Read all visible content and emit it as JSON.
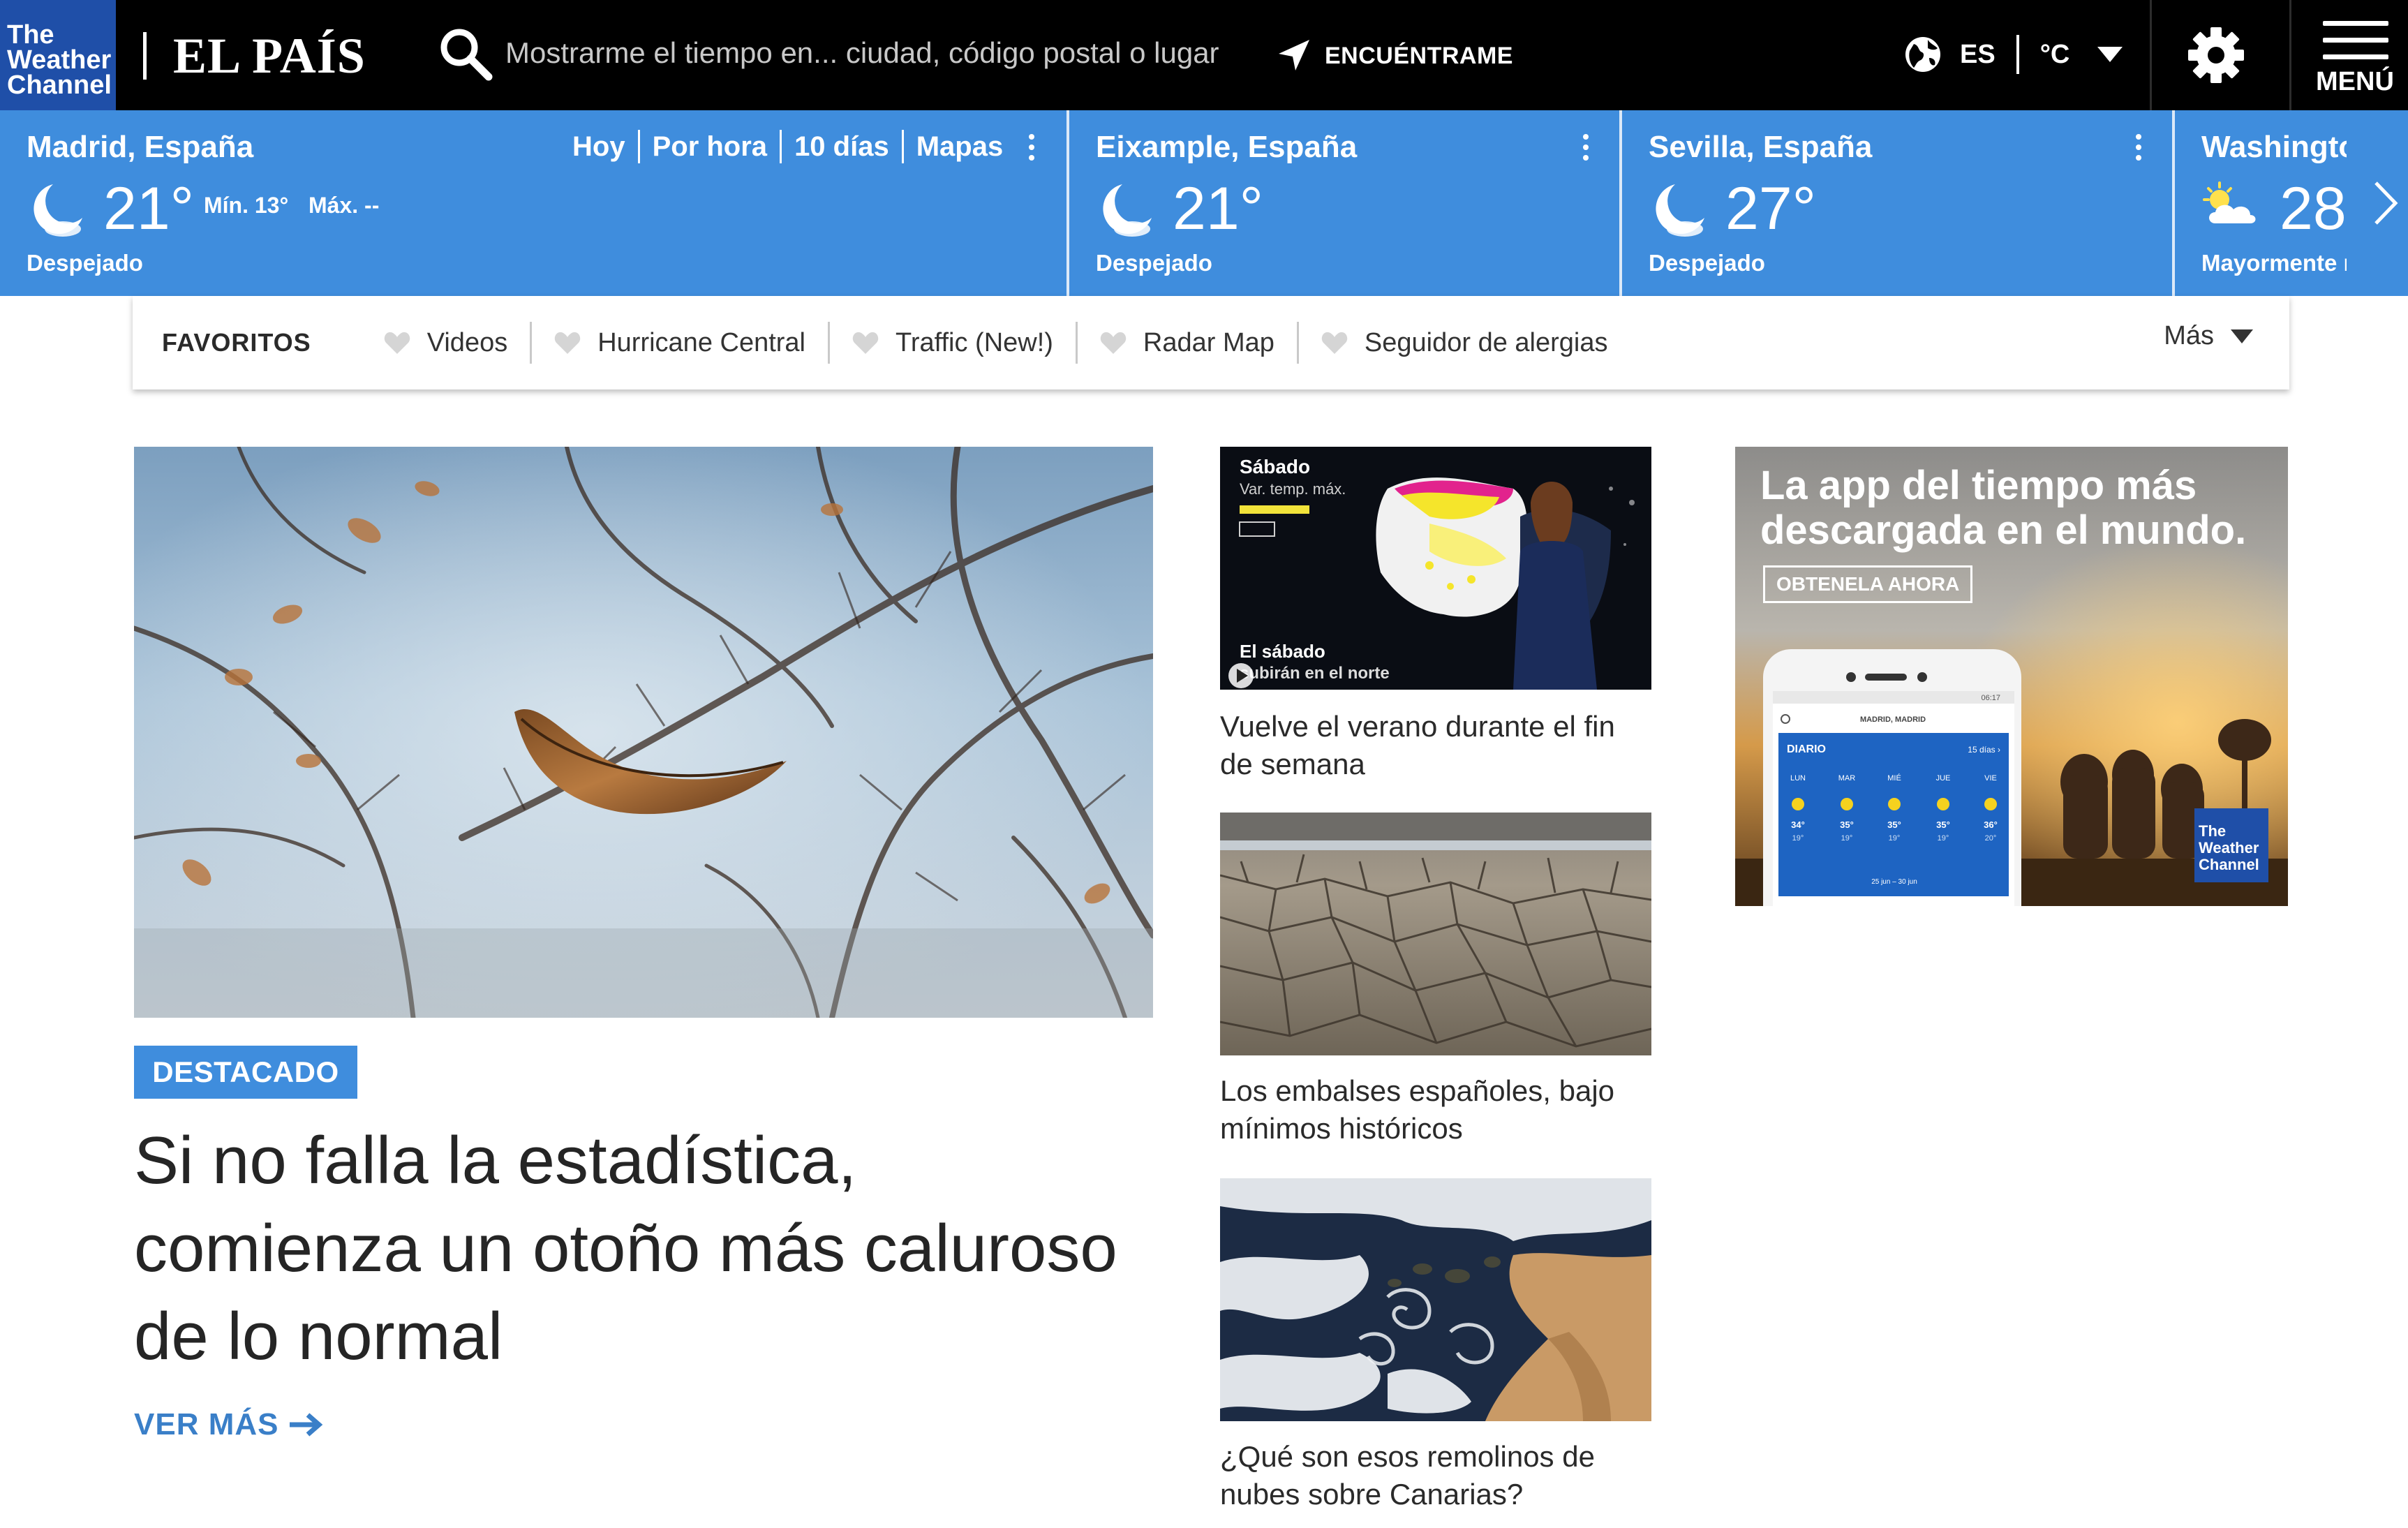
{
  "header": {
    "twc_logo_lines": [
      "The",
      "Weather",
      "Channel"
    ],
    "partner_name": "EL PAÍS",
    "search_placeholder": "Mostrarme el tiempo en... ciudad, código postal o lugar",
    "find_me_label": "ENCUÉNTRAME",
    "language": "ES",
    "units": "°C",
    "menu_label": "MENÚ"
  },
  "locations": [
    {
      "name": "Madrid, España",
      "temp": "21°",
      "min": "Mín. 13°",
      "max": "Máx. --",
      "condition": "Despejado",
      "icon": "clear-night-icon",
      "tabs": [
        "Hoy",
        "Por hora",
        "10 días",
        "Mapas"
      ]
    },
    {
      "name": "Eixample, España",
      "temp": "21°",
      "condition": "Despejado",
      "icon": "clear-night-icon"
    },
    {
      "name": "Sevilla, España",
      "temp": "27°",
      "condition": "Despejado",
      "icon": "clear-night-icon"
    },
    {
      "name": "Washington",
      "temp": "28",
      "condition": "Mayormente n",
      "icon": "partly-cloudy-icon"
    }
  ],
  "favorites": {
    "title": "FAVORITOS",
    "items": [
      "Videos",
      "Hurricane Central",
      "Traffic (New!)",
      "Radar Map",
      "Seguidor de alergias"
    ],
    "more_label": "Más"
  },
  "hero": {
    "badge": "DESTACADO",
    "title_lines": [
      "Si no falla la estadística,",
      "comienza un otoño más caluroso",
      "de lo normal"
    ],
    "more_label": "VER MÁS"
  },
  "stories": [
    {
      "title_lines": [
        "Vuelve el verano durante el fin",
        "de semana"
      ],
      "overlay_top": "Sábado",
      "overlay_sub": "Var. temp. máx.",
      "overlay_bottom_1": "El sábado",
      "overlay_bottom_2": "subirán en el norte"
    },
    {
      "title_lines": [
        "Los embalses españoles, bajo",
        "mínimos históricos"
      ]
    },
    {
      "title_lines": [
        "¿Qué son esos remolinos de",
        "nubes sobre Canarias?"
      ]
    }
  ],
  "ad": {
    "headline_lines": [
      "La app del tiempo más",
      "descargada en el mundo."
    ],
    "cta": "OBTENELA AHORA",
    "phone_location": "MADRID, MADRID",
    "phone_time": "06:17",
    "phone_panel_title": "DIARIO",
    "phone_panel_link": "15 días ›",
    "phone_days": [
      "LUN",
      "MAR",
      "MIÉ",
      "JUE",
      "VIE"
    ],
    "phone_highs": [
      "34°",
      "35°",
      "35°",
      "35°",
      "36°"
    ],
    "phone_lows": [
      "19°",
      "19°",
      "19°",
      "19°",
      "20°"
    ],
    "phone_range": "25 jun – 30 jun",
    "brand_lines": [
      "The",
      "Weather",
      "Channel"
    ]
  },
  "colors": {
    "header_bg": "#000000",
    "strip_blue": "#3f8ddd",
    "twc_blue": "#1f4fa8",
    "accent_link": "#3a7fc8"
  }
}
